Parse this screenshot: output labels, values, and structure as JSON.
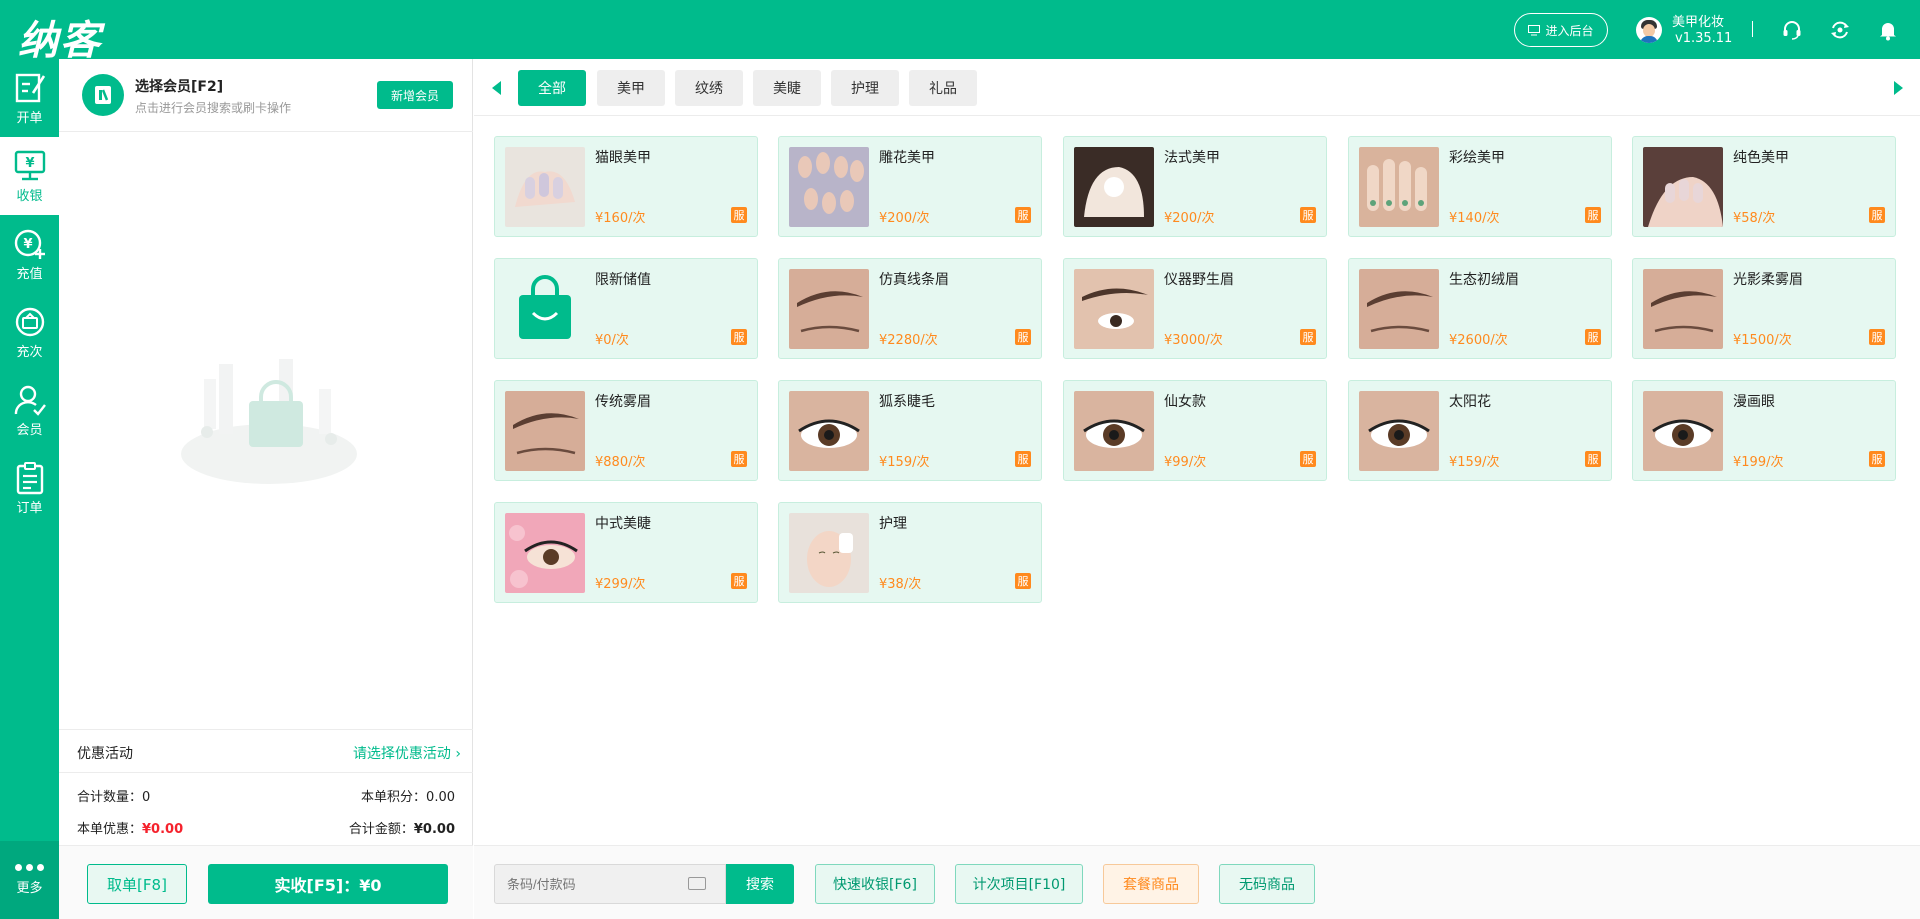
{
  "header": {
    "logo_text": "纳客",
    "backend_button": "进入后台",
    "user_name": "美甲化妆",
    "version": "v1.35.11",
    "icons": [
      "headset-icon",
      "sync-icon",
      "bell-icon"
    ]
  },
  "sidebar": {
    "items": [
      {
        "label": "开单",
        "icon": "edit-icon"
      },
      {
        "label": "收银",
        "icon": "cashier-icon"
      },
      {
        "label": "充值",
        "icon": "recharge-icon"
      },
      {
        "label": "充次",
        "icon": "count-recharge-icon"
      },
      {
        "label": "会员",
        "icon": "member-icon"
      },
      {
        "label": "订单",
        "icon": "order-icon"
      }
    ],
    "active_index": 1,
    "more_label": "更多"
  },
  "member": {
    "title": "选择会员[F2]",
    "subtitle": "点击进行会员搜索或刷卡操作",
    "new_member_button": "新增会员",
    "promo_label": "优惠活动",
    "promo_select": "请选择优惠活动 ›",
    "total_qty_label": "合计数量：",
    "total_qty": "0",
    "points_label": "本单积分：",
    "points": "0.00",
    "discount_label": "本单优惠：",
    "discount": "¥0.00",
    "total_amount_label": "合计金额：",
    "total_amount": "¥0.00",
    "cancel_button": "取单[F8]",
    "pay_button": "实收[F5]：¥0"
  },
  "tabs": [
    "全部",
    "美甲",
    "纹绣",
    "美睫",
    "护理",
    "礼品"
  ],
  "active_tab": 0,
  "products": [
    {
      "name": "猫眼美甲",
      "price": "¥160/次",
      "thumb": "nail"
    },
    {
      "name": "雕花美甲",
      "price": "¥200/次",
      "thumb": "nail-carved"
    },
    {
      "name": "法式美甲",
      "price": "¥200/次",
      "thumb": "nail-french"
    },
    {
      "name": "彩绘美甲",
      "price": "¥140/次",
      "thumb": "nail-painted"
    },
    {
      "name": "纯色美甲",
      "price": "¥58/次",
      "thumb": "nail-solid"
    },
    {
      "name": "限新储值",
      "price": "¥0/次",
      "thumb": "bag"
    },
    {
      "name": "仿真线条眉",
      "price": "¥2280/次",
      "thumb": "brow"
    },
    {
      "name": "仪器野生眉",
      "price": "¥3000/次",
      "thumb": "brow-eye"
    },
    {
      "name": "生态初绒眉",
      "price": "¥2600/次",
      "thumb": "brow"
    },
    {
      "name": "光影柔雾眉",
      "price": "¥1500/次",
      "thumb": "brow"
    },
    {
      "name": "传统雾眉",
      "price": "¥880/次",
      "thumb": "brow"
    },
    {
      "name": "狐系睫毛",
      "price": "¥159/次",
      "thumb": "eye"
    },
    {
      "name": "仙女款",
      "price": "¥99/次",
      "thumb": "eye"
    },
    {
      "name": "太阳花",
      "price": "¥159/次",
      "thumb": "eye"
    },
    {
      "name": "漫画眼",
      "price": "¥199/次",
      "thumb": "eye"
    },
    {
      "name": "中式美睫",
      "price": "¥299/次",
      "thumb": "eye-pink"
    },
    {
      "name": "护理",
      "price": "¥38/次",
      "thumb": "face"
    }
  ],
  "service_badge": "服",
  "bottom": {
    "search_placeholder": "条码/付款码",
    "search_button": "搜索",
    "quick_checkout": "快速收银[F6]",
    "count_items": "计次项目[F10]",
    "package_goods": "套餐商品",
    "no_code_goods": "无码商品"
  },
  "colors": {
    "brand": "#00BB8C",
    "price": "#FF8A1E",
    "discount": "#F5222D"
  }
}
